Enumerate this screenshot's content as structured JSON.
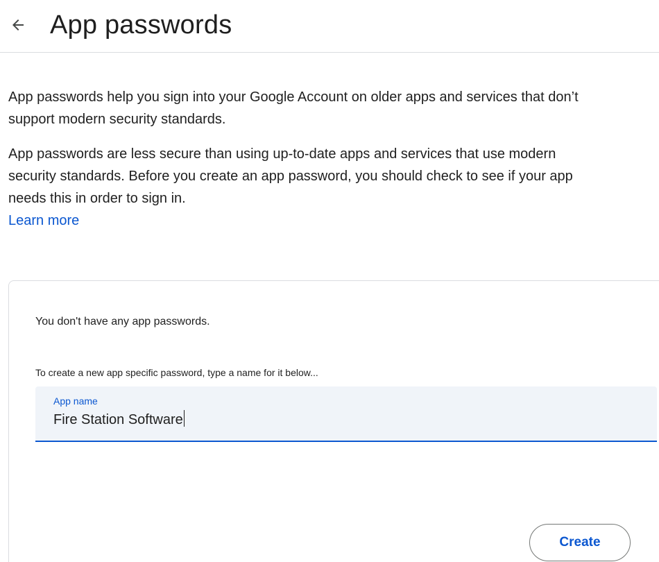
{
  "header": {
    "back_icon": "arrow-left-icon",
    "title": "App passwords"
  },
  "intro": {
    "paragraph1": "App passwords help you sign into your Google Account on older apps and services that don’t support modern security standards.",
    "paragraph2": "App passwords are less secure than using up-to-date apps and services that use modern security standards. Before you create an app password, you should check to see if your app needs this in order to sign in.",
    "learn_more": "Learn more"
  },
  "card": {
    "empty_message": "You don't have any app passwords.",
    "instruction": "To create a new app specific password, type a name for it below...",
    "app_name_field": {
      "label": "App name",
      "value": "Fire Station Software"
    },
    "create_button": "Create"
  },
  "colors": {
    "accent": "#0b57d0",
    "text": "#1f1f1f",
    "field_background": "#f0f4f9",
    "divider": "#dadce0"
  }
}
